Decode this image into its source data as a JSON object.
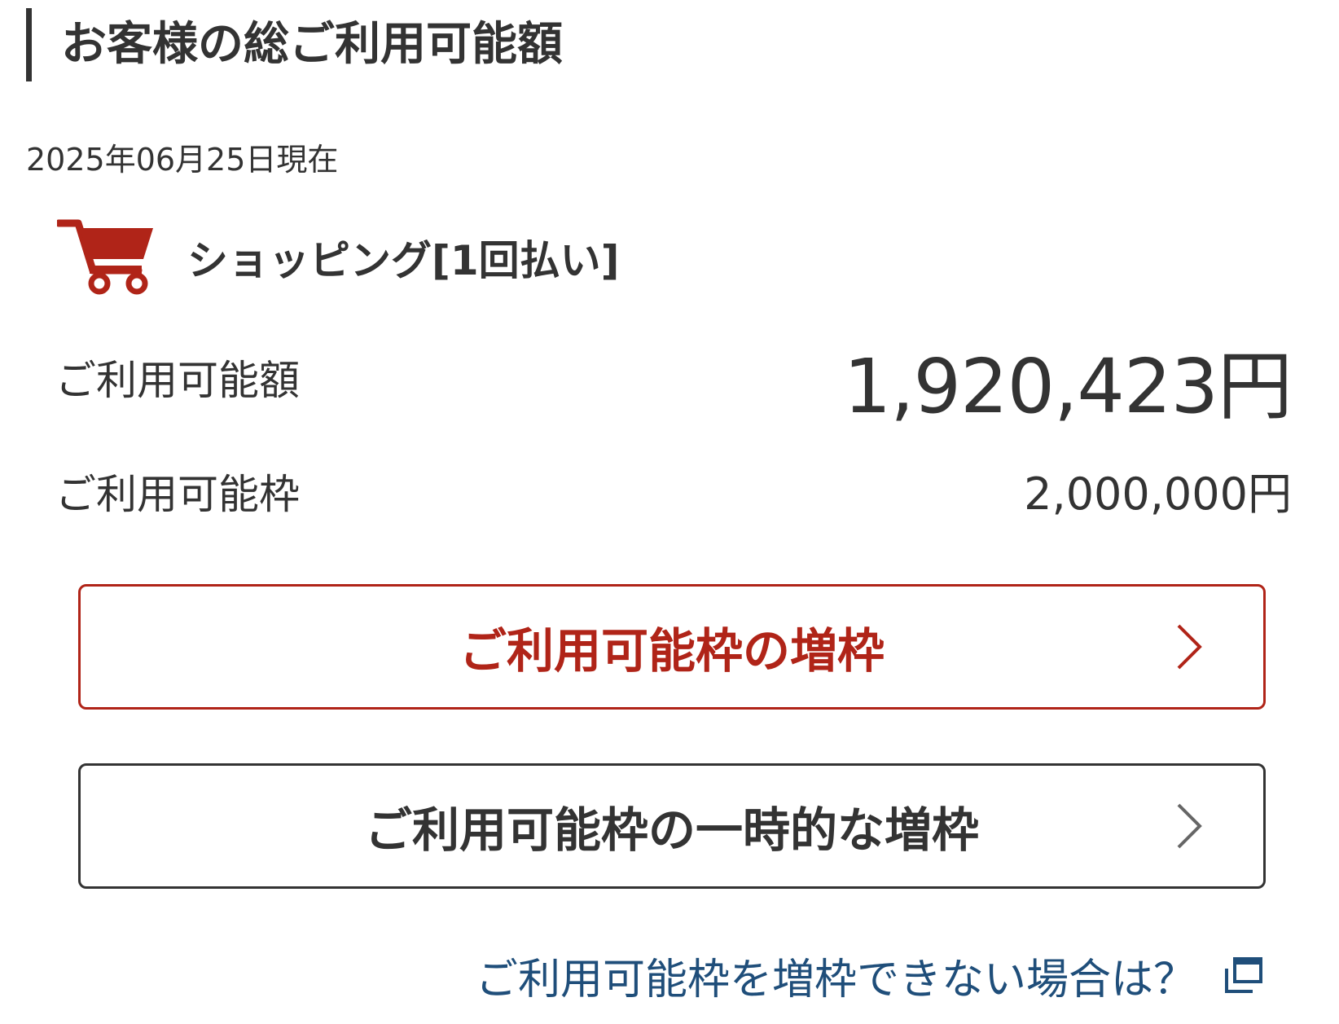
{
  "header": {
    "title": "お客様の総ご利用可能額"
  },
  "as_of": "2025年06月25日現在",
  "shopping": {
    "icon": "shopping-cart-icon",
    "label": "ショッピング[1回払い]",
    "icon_color": "#b02418"
  },
  "available_amount": {
    "label": "ご利用可能額",
    "value": "1,920,423円"
  },
  "credit_limit": {
    "label": "ご利用可能枠",
    "value": "2,000,000円"
  },
  "buttons": {
    "increase_limit": "ご利用可能枠の増枠",
    "temporary_increase": "ご利用可能枠の一時的な増枠"
  },
  "help_link": {
    "label": "ご利用可能枠を増枠できない場合は？",
    "icon": "external-link-icon"
  },
  "colors": {
    "accent": "#b02418",
    "link": "#1f4e7a",
    "text": "#333333"
  }
}
